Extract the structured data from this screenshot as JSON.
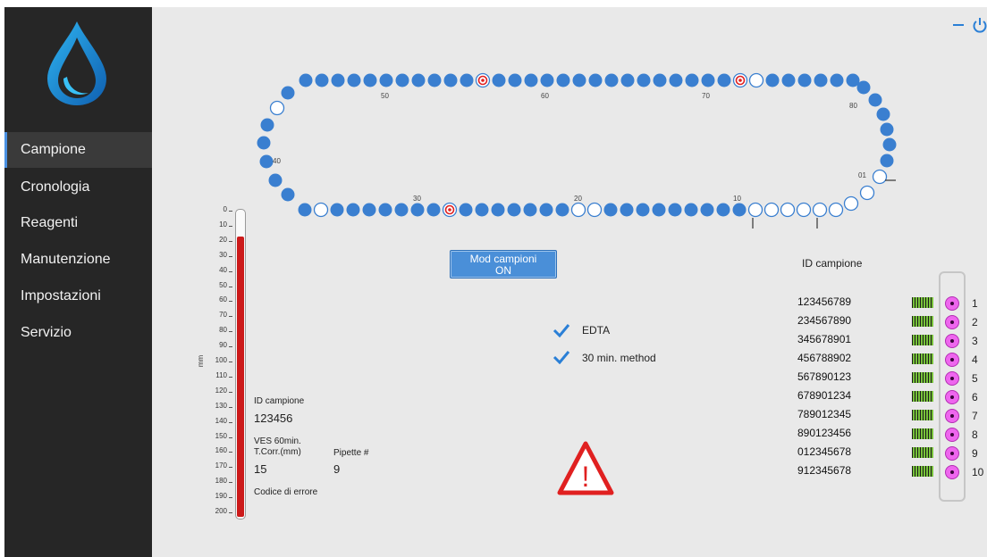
{
  "sidebar": {
    "items": [
      {
        "label": "Campione",
        "active": true
      },
      {
        "label": "Cronologia",
        "active": false
      },
      {
        "label": "Reagenti",
        "active": false
      },
      {
        "label": "Manutenzione",
        "active": false
      },
      {
        "label": "Impostazioni",
        "active": false
      },
      {
        "label": "Servizio",
        "active": false
      }
    ]
  },
  "window": {
    "minimize_icon": "minimize-icon",
    "power_icon": "power-icon",
    "accent": "#2a7fd6"
  },
  "carousel": {
    "position_labels": [
      "50",
      "60",
      "70",
      "80",
      "01",
      "10",
      "20",
      "30",
      "40"
    ],
    "highlighted_positions_icon": "red-target-icon"
  },
  "scale": {
    "unit": "mm",
    "ticks": [
      "0",
      "10",
      "20",
      "30",
      "40",
      "50",
      "60",
      "70",
      "80",
      "90",
      "100",
      "110",
      "120",
      "130",
      "140",
      "150",
      "160",
      "170",
      "180",
      "190",
      "200"
    ],
    "fill_color": "#cc1a1a"
  },
  "sample": {
    "id_label": "ID campione",
    "id_value": "123456",
    "ves_label_1": "VES 60min.",
    "ves_label_2": "T.Corr.(mm)",
    "ves_value": "15",
    "pipette_label": "Pipette #",
    "pipette_value": "9",
    "error_label": "Codice di errore"
  },
  "mode_button": {
    "line1": "Mod campioni",
    "line2": "ON"
  },
  "options": [
    {
      "label": "EDTA",
      "checked": true
    },
    {
      "label": "30 min. method",
      "checked": true
    }
  ],
  "warning_icon": "warning-icon",
  "rack": {
    "header": "ID campione",
    "rows": [
      {
        "id": "123456789",
        "num": "1"
      },
      {
        "id": "234567890",
        "num": "2"
      },
      {
        "id": "345678901",
        "num": "3"
      },
      {
        "id": "456788902",
        "num": "4"
      },
      {
        "id": "567890123",
        "num": "5"
      },
      {
        "id": "678901234",
        "num": "6"
      },
      {
        "id": "789012345",
        "num": "7"
      },
      {
        "id": "890123456",
        "num": "8"
      },
      {
        "id": "012345678",
        "num": "9"
      },
      {
        "id": "912345678",
        "num": "10"
      }
    ]
  }
}
